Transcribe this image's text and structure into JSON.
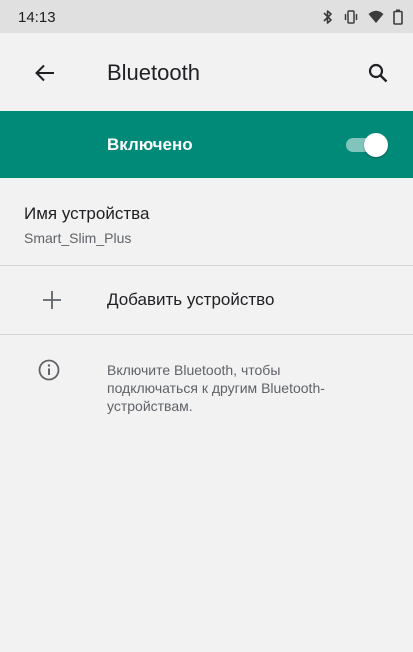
{
  "status_bar": {
    "time": "14:13",
    "icons": [
      "bluetooth-icon",
      "vibrate-icon",
      "wifi-icon",
      "battery-icon"
    ]
  },
  "app_bar": {
    "back_icon": "arrow-back-icon",
    "title": "Bluetooth",
    "search_icon": "search-icon"
  },
  "master_switch": {
    "label": "Включено",
    "checked": true,
    "color": "#028a79"
  },
  "device_name": {
    "title": "Имя устройства",
    "value": "Smart_Slim_Plus"
  },
  "add_device": {
    "icon": "plus-icon",
    "label": "Добавить устройство"
  },
  "footer": {
    "icon": "info-icon",
    "text": "Включите Bluetooth, чтобы подключаться к другим Bluetooth-устройствам."
  }
}
